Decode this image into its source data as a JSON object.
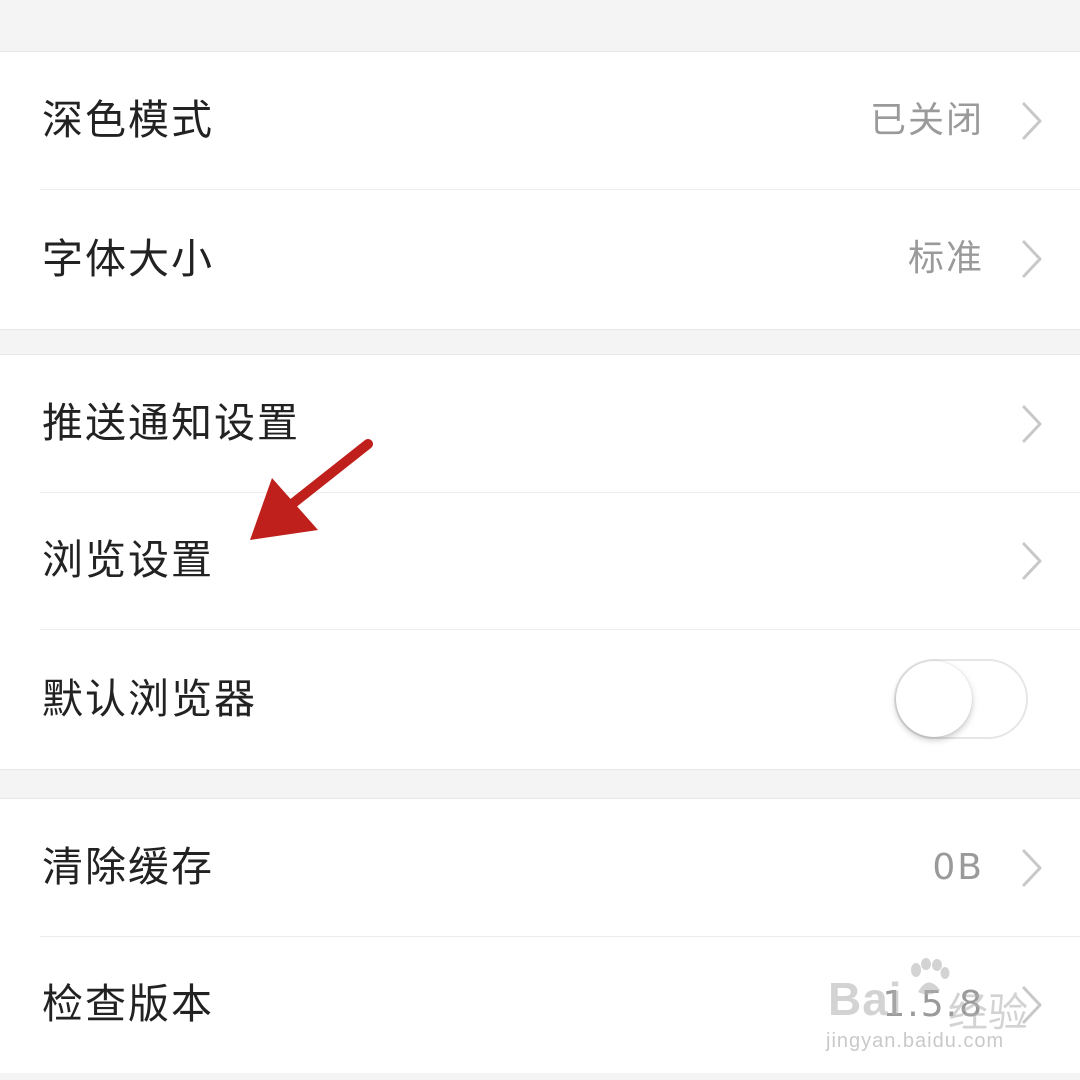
{
  "settings": {
    "group1": [
      {
        "label": "深色模式",
        "value": "已关闭"
      },
      {
        "label": "字体大小",
        "value": "标准"
      }
    ],
    "group2": [
      {
        "label": "推送通知设置"
      },
      {
        "label": "浏览设置"
      },
      {
        "label": "默认浏览器",
        "toggle": false
      }
    ],
    "group3": [
      {
        "label": "清除缓存",
        "value": "0B"
      },
      {
        "label": "检查版本",
        "value": "1.5.8"
      }
    ]
  },
  "annotation": {
    "arrow_color": "#c0201c",
    "points_to": "浏览设置"
  },
  "watermark": {
    "brand": "Bai",
    "suffix": "经验",
    "url": "jingyan.baidu.com"
  },
  "colors": {
    "background": "#f4f4f4",
    "row": "#ffffff",
    "label": "#222222",
    "value": "#9a9a9a",
    "chevron": "#c8c8c8"
  }
}
